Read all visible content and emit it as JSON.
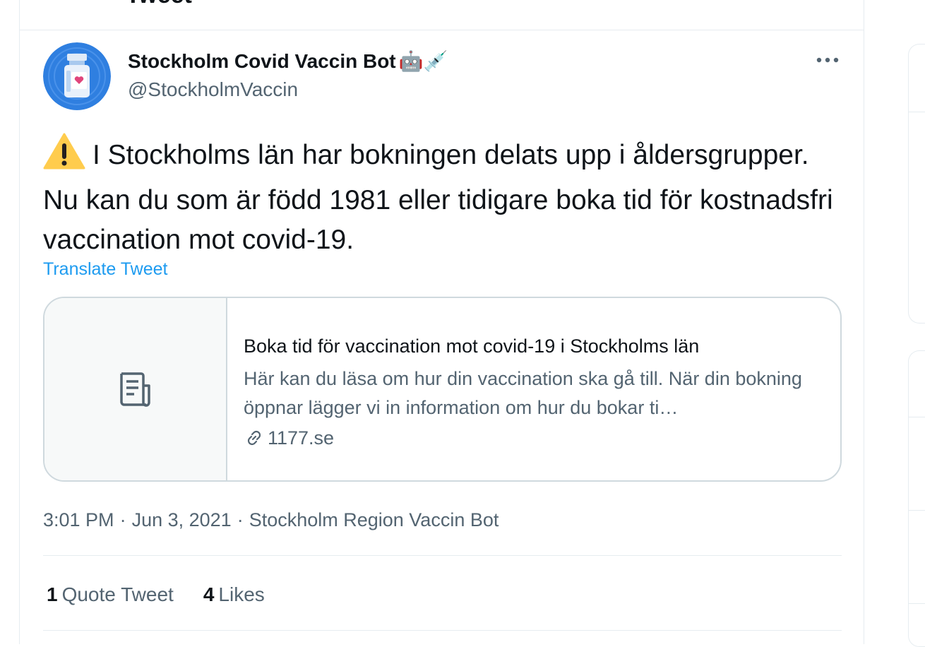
{
  "header": {
    "title": "Tweet"
  },
  "tweet": {
    "author_name": "Stockholm Covid Vaccin Bot",
    "author_emojis": "🤖💉",
    "author_handle": "@StockholmVaccin",
    "text": "I Stockholms län har bokningen delats upp i åldersgrupper. Nu kan du som är född 1981 eller tidigare boka tid för kostnadsfri vaccination mot covid-19.",
    "translate_label": "Translate Tweet",
    "card": {
      "title": "Boka tid för vaccination mot covid-19 i Stockholms län",
      "description": "Här kan du läsa om hur din vaccination ska gå till. När din bokning öppnar lägger vi in information om hur du bokar ti…",
      "domain": "1177.se"
    },
    "time": "3:01 PM",
    "date": "Jun 3, 2021",
    "source": "Stockholm Region Vaccin Bot",
    "separator": "·",
    "stats": {
      "quote_count": "1",
      "quote_label": "Quote Tweet",
      "likes_count": "4",
      "likes_label": "Likes"
    }
  },
  "icons": {
    "warning": "warning-icon",
    "more": "more-icon",
    "article": "article-icon",
    "link": "link-icon"
  },
  "colors": {
    "accent": "#1d9bf0",
    "text_primary": "#0f1419",
    "text_secondary": "#536471",
    "border": "#cfd9de",
    "avatar_bg": "#2f7fe0"
  }
}
